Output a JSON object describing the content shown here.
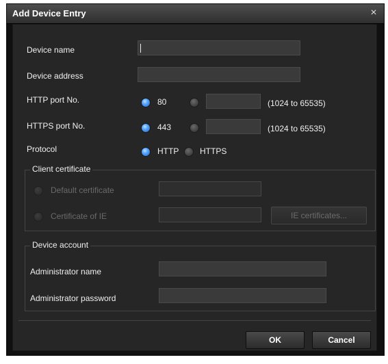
{
  "dialog": {
    "title": "Add Device Entry",
    "close_symbol": "×"
  },
  "fields": {
    "device_name_label": "Device name",
    "device_name_value": "",
    "device_address_label": "Device address",
    "device_address_value": "",
    "http_port_label": "HTTP port No.",
    "http_port_default": "80",
    "http_port_custom_value": "",
    "http_port_range": "(1024 to 65535)",
    "https_port_label": "HTTPS port No.",
    "https_port_default": "443",
    "https_port_custom_value": "",
    "https_port_range": "(1024 to 65535)",
    "protocol_label": "Protocol",
    "protocol_http": "HTTP",
    "protocol_https": "HTTPS",
    "selected_http_port": "default",
    "selected_https_port": "default",
    "selected_protocol": "HTTP"
  },
  "client_certificate": {
    "legend": "Client certificate",
    "default_certificate_label": "Default certificate",
    "certificate_of_ie_label": "Certificate of IE",
    "ie_certificates_button": "IE certificates...",
    "enabled": false
  },
  "device_account": {
    "legend": "Device account",
    "admin_name_label": "Administrator name",
    "admin_name_value": "",
    "admin_password_label": "Administrator password",
    "admin_password_value": ""
  },
  "buttons": {
    "ok": "OK",
    "cancel": "Cancel"
  },
  "colors": {
    "dialog_bg": "#262626",
    "title_bar": "#3a3a3a",
    "radio_selected": "#3a86e8",
    "text": "#f0f0f0",
    "disabled_text": "#6a6a6a"
  }
}
